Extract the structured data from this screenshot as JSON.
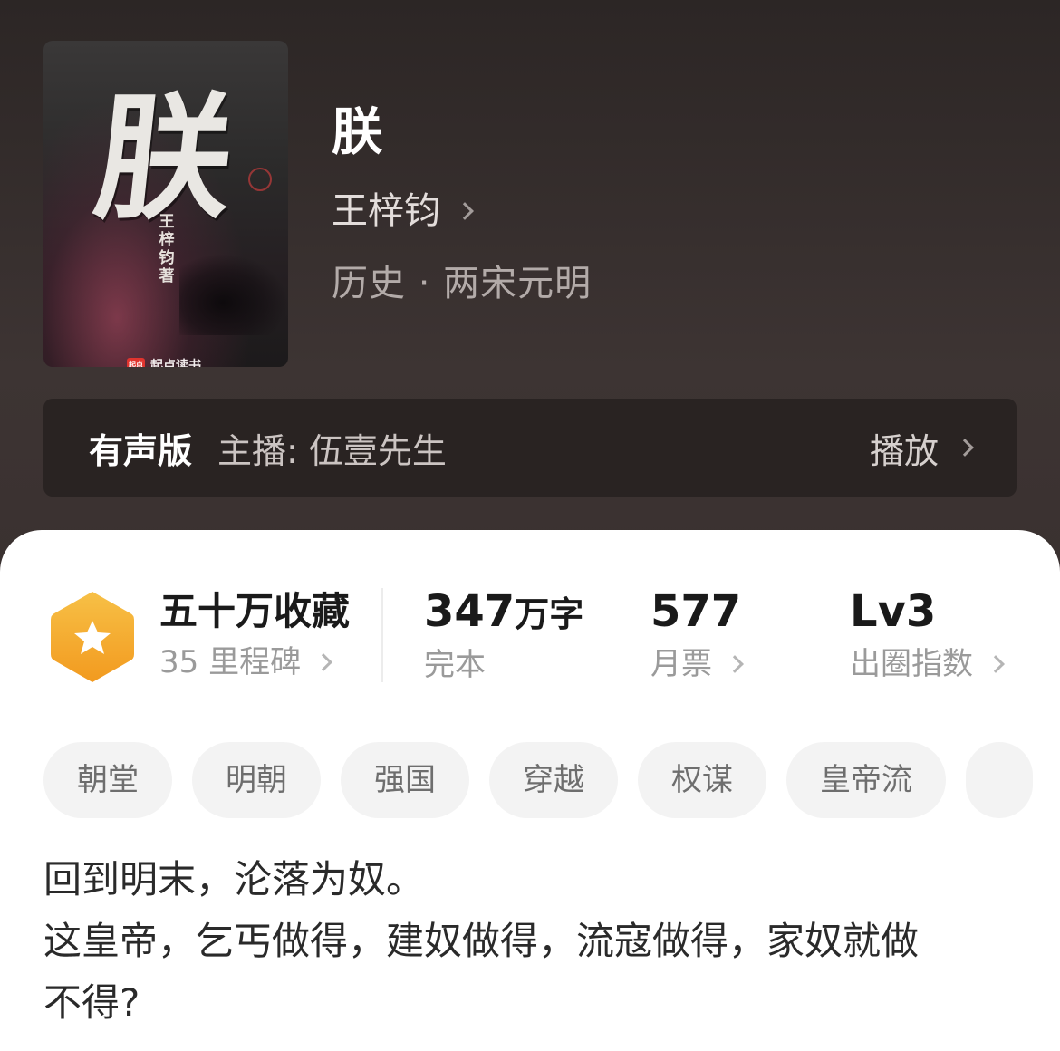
{
  "book": {
    "cover": {
      "big_char": "朕",
      "author_vertical": "王梓钧著",
      "publisher": "起点读书",
      "publisher_logo": "起点"
    },
    "title": "朕",
    "author": "王梓钧",
    "genre": "历史 · 两宋元明"
  },
  "audio": {
    "badge": "有声版",
    "host": "主播: 伍壹先生",
    "play_label": "播放"
  },
  "stats": {
    "collection": {
      "title": "五十万收藏",
      "milestone": "35 里程碑"
    },
    "words": {
      "value": "347",
      "unit": "万字",
      "status": "完本"
    },
    "tickets": {
      "value": "577",
      "label": "月票"
    },
    "index": {
      "value": "Lv3",
      "label": "出圈指数"
    }
  },
  "tags": [
    "朝堂",
    "明朝",
    "强国",
    "穿越",
    "权谋",
    "皇帝流",
    ""
  ],
  "synopsis": {
    "line1": "回到明末，沦落为奴。",
    "line2": "这皇帝，乞丐做得，建奴做得，流寇做得，家奴就做",
    "line3": "不得?"
  },
  "colors": {
    "header_bg": "#3a3130",
    "medal_orange": "#f5a623",
    "audio_bar": "#292322"
  }
}
